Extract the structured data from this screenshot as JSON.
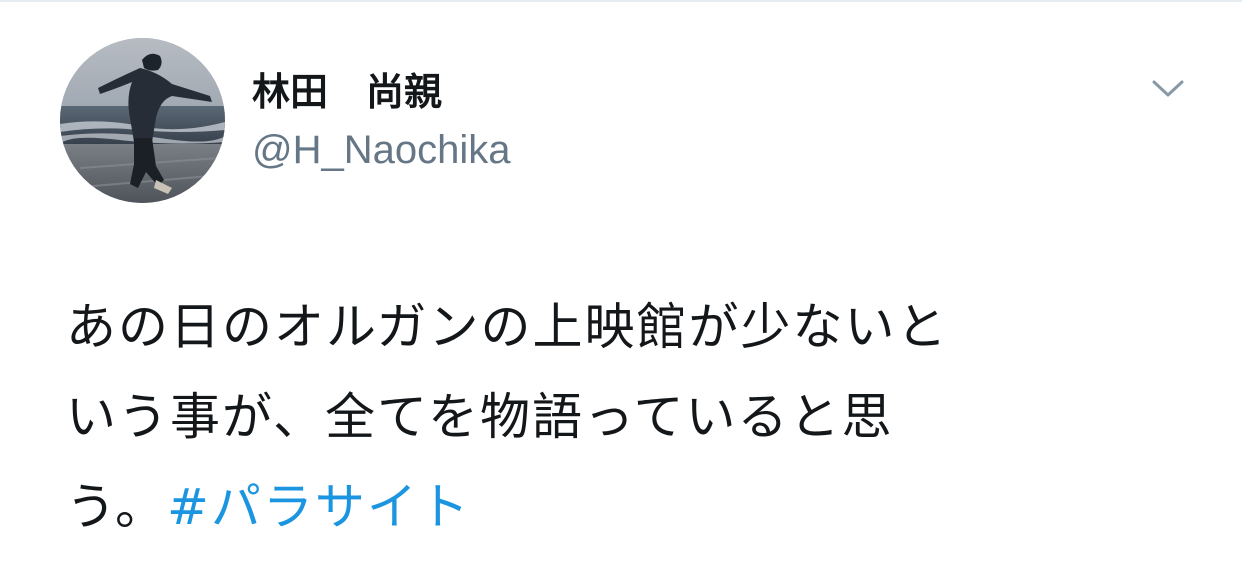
{
  "author": {
    "display_name": "林田　尚親",
    "handle": "@H_Naochika"
  },
  "tweet": {
    "text_line_1": "あの日のオルガンの上映館が少ないと",
    "text_line_2": "いう事が、全てを物語っていると思",
    "text_line_3": "う。",
    "hashtag": "#パラサイト"
  },
  "icons": {
    "menu": "chevron-down-icon",
    "avatar": "profile-photo"
  },
  "colors": {
    "text": "#14171a",
    "secondary": "#657786",
    "link": "#1b95e0"
  }
}
